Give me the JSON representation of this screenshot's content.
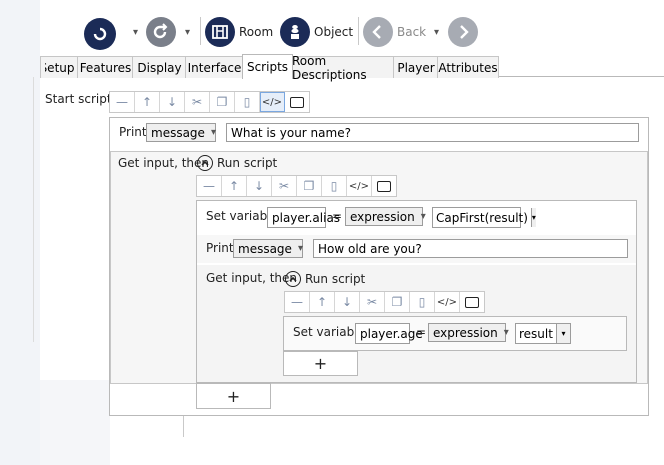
{
  "ribbon": {
    "room_label": "Room",
    "object_label": "Object",
    "back_label": "Back"
  },
  "tabs": [
    {
      "label": "Setup"
    },
    {
      "label": "Features"
    },
    {
      "label": "Display"
    },
    {
      "label": "Interface"
    },
    {
      "label": "Scripts"
    },
    {
      "label": "Room Descriptions"
    },
    {
      "label": "Player"
    },
    {
      "label": "Attributes"
    }
  ],
  "active_tab": "Scripts",
  "start_script_label": "Start script:",
  "script": {
    "print1": {
      "command": "Print",
      "mode": "message",
      "text": "What is your name?"
    },
    "input1": {
      "command": "Get input, then",
      "run_label": "Run script",
      "setvar": {
        "command": "Set variable",
        "name": "player.alias",
        "equals": "=",
        "mode": "expression",
        "value": "CapFirst(result)"
      },
      "print2": {
        "command": "Print",
        "mode": "message",
        "text": "How old are you?"
      },
      "input2": {
        "command": "Get input, then",
        "run_label": "Run script",
        "setvar": {
          "command": "Set variable",
          "name": "player.age",
          "equals": "=",
          "mode": "expression",
          "value": "result"
        }
      }
    }
  },
  "add_symbol": "+"
}
